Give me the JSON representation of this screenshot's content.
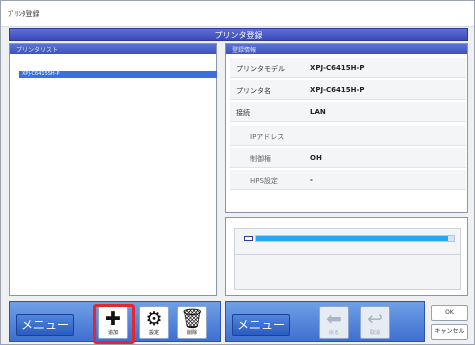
{
  "window": {
    "title": "ﾌﾟﾘﾝﾀ登録"
  },
  "banner": {
    "title": "プリンタ登録"
  },
  "left_panel": {
    "header": "プリンタリスト",
    "selected_item": "XPJ-C6415SH-P"
  },
  "detail_panel": {
    "header": "登録情報",
    "rows": [
      {
        "label": "プリンタモデル",
        "value": "XPJ-C6415H-P"
      },
      {
        "label": "プリンタ名",
        "value": "XPJ-C6415H-P"
      },
      {
        "label": "接続",
        "value": "LAN"
      },
      {
        "label": "IPアドレス",
        "value": ""
      },
      {
        "label": "制御権",
        "value": "OH"
      },
      {
        "label": "HPS設定",
        "value": "-"
      }
    ]
  },
  "progress": {
    "value": 0.97
  },
  "toolbar": {
    "menu_left": "メニュー",
    "menu_right": "メニュー",
    "add_icon": "plus-icon",
    "add_label": "追加",
    "settings_icon": "gear-icon",
    "settings_label": "設定",
    "delete_icon": "trash-icon",
    "delete_label": "削除",
    "back_label": "戻る",
    "undo_label": "取消",
    "ok_label": "OK",
    "cancel_label": "キャンセル"
  },
  "colors": {
    "accent": "#3a49b8",
    "toolbar": "#3f6fd0",
    "highlight": "#e5262c",
    "progress": "#29a7f0"
  }
}
